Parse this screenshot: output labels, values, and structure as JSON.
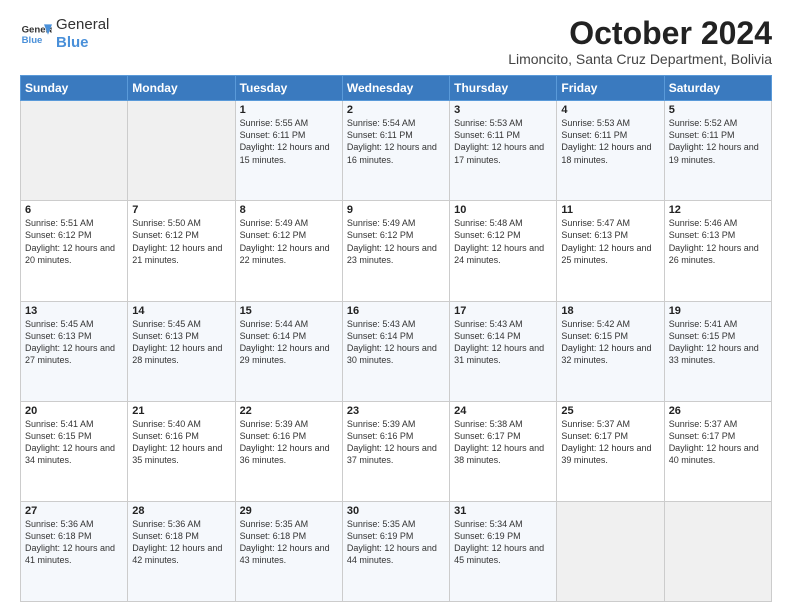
{
  "header": {
    "logo_line1": "General",
    "logo_line2": "Blue",
    "main_title": "October 2024",
    "subtitle": "Limoncito, Santa Cruz Department, Bolivia"
  },
  "days_of_week": [
    "Sunday",
    "Monday",
    "Tuesday",
    "Wednesday",
    "Thursday",
    "Friday",
    "Saturday"
  ],
  "weeks": [
    [
      {
        "day": "",
        "info": ""
      },
      {
        "day": "",
        "info": ""
      },
      {
        "day": "1",
        "info": "Sunrise: 5:55 AM\nSunset: 6:11 PM\nDaylight: 12 hours and 15 minutes."
      },
      {
        "day": "2",
        "info": "Sunrise: 5:54 AM\nSunset: 6:11 PM\nDaylight: 12 hours and 16 minutes."
      },
      {
        "day": "3",
        "info": "Sunrise: 5:53 AM\nSunset: 6:11 PM\nDaylight: 12 hours and 17 minutes."
      },
      {
        "day": "4",
        "info": "Sunrise: 5:53 AM\nSunset: 6:11 PM\nDaylight: 12 hours and 18 minutes."
      },
      {
        "day": "5",
        "info": "Sunrise: 5:52 AM\nSunset: 6:11 PM\nDaylight: 12 hours and 19 minutes."
      }
    ],
    [
      {
        "day": "6",
        "info": "Sunrise: 5:51 AM\nSunset: 6:12 PM\nDaylight: 12 hours and 20 minutes."
      },
      {
        "day": "7",
        "info": "Sunrise: 5:50 AM\nSunset: 6:12 PM\nDaylight: 12 hours and 21 minutes."
      },
      {
        "day": "8",
        "info": "Sunrise: 5:49 AM\nSunset: 6:12 PM\nDaylight: 12 hours and 22 minutes."
      },
      {
        "day": "9",
        "info": "Sunrise: 5:49 AM\nSunset: 6:12 PM\nDaylight: 12 hours and 23 minutes."
      },
      {
        "day": "10",
        "info": "Sunrise: 5:48 AM\nSunset: 6:12 PM\nDaylight: 12 hours and 24 minutes."
      },
      {
        "day": "11",
        "info": "Sunrise: 5:47 AM\nSunset: 6:13 PM\nDaylight: 12 hours and 25 minutes."
      },
      {
        "day": "12",
        "info": "Sunrise: 5:46 AM\nSunset: 6:13 PM\nDaylight: 12 hours and 26 minutes."
      }
    ],
    [
      {
        "day": "13",
        "info": "Sunrise: 5:45 AM\nSunset: 6:13 PM\nDaylight: 12 hours and 27 minutes."
      },
      {
        "day": "14",
        "info": "Sunrise: 5:45 AM\nSunset: 6:13 PM\nDaylight: 12 hours and 28 minutes."
      },
      {
        "day": "15",
        "info": "Sunrise: 5:44 AM\nSunset: 6:14 PM\nDaylight: 12 hours and 29 minutes."
      },
      {
        "day": "16",
        "info": "Sunrise: 5:43 AM\nSunset: 6:14 PM\nDaylight: 12 hours and 30 minutes."
      },
      {
        "day": "17",
        "info": "Sunrise: 5:43 AM\nSunset: 6:14 PM\nDaylight: 12 hours and 31 minutes."
      },
      {
        "day": "18",
        "info": "Sunrise: 5:42 AM\nSunset: 6:15 PM\nDaylight: 12 hours and 32 minutes."
      },
      {
        "day": "19",
        "info": "Sunrise: 5:41 AM\nSunset: 6:15 PM\nDaylight: 12 hours and 33 minutes."
      }
    ],
    [
      {
        "day": "20",
        "info": "Sunrise: 5:41 AM\nSunset: 6:15 PM\nDaylight: 12 hours and 34 minutes."
      },
      {
        "day": "21",
        "info": "Sunrise: 5:40 AM\nSunset: 6:16 PM\nDaylight: 12 hours and 35 minutes."
      },
      {
        "day": "22",
        "info": "Sunrise: 5:39 AM\nSunset: 6:16 PM\nDaylight: 12 hours and 36 minutes."
      },
      {
        "day": "23",
        "info": "Sunrise: 5:39 AM\nSunset: 6:16 PM\nDaylight: 12 hours and 37 minutes."
      },
      {
        "day": "24",
        "info": "Sunrise: 5:38 AM\nSunset: 6:17 PM\nDaylight: 12 hours and 38 minutes."
      },
      {
        "day": "25",
        "info": "Sunrise: 5:37 AM\nSunset: 6:17 PM\nDaylight: 12 hours and 39 minutes."
      },
      {
        "day": "26",
        "info": "Sunrise: 5:37 AM\nSunset: 6:17 PM\nDaylight: 12 hours and 40 minutes."
      }
    ],
    [
      {
        "day": "27",
        "info": "Sunrise: 5:36 AM\nSunset: 6:18 PM\nDaylight: 12 hours and 41 minutes."
      },
      {
        "day": "28",
        "info": "Sunrise: 5:36 AM\nSunset: 6:18 PM\nDaylight: 12 hours and 42 minutes."
      },
      {
        "day": "29",
        "info": "Sunrise: 5:35 AM\nSunset: 6:18 PM\nDaylight: 12 hours and 43 minutes."
      },
      {
        "day": "30",
        "info": "Sunrise: 5:35 AM\nSunset: 6:19 PM\nDaylight: 12 hours and 44 minutes."
      },
      {
        "day": "31",
        "info": "Sunrise: 5:34 AM\nSunset: 6:19 PM\nDaylight: 12 hours and 45 minutes."
      },
      {
        "day": "",
        "info": ""
      },
      {
        "day": "",
        "info": ""
      }
    ]
  ]
}
